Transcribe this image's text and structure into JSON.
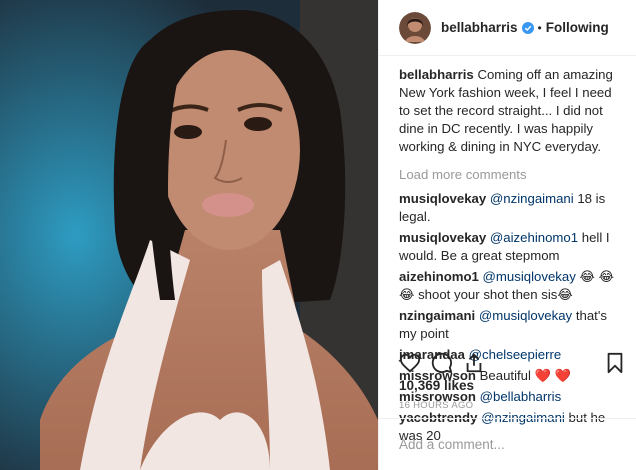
{
  "post": {
    "username": "bellabharris",
    "follow_status": "Following",
    "separator": "•",
    "caption": {
      "username": "bellabharris",
      "text": "Coming off an amazing New York fashion week, I feel I need to set the record straight... I did not dine in DC recently. I was happily working & dining in NYC everyday."
    },
    "load_more": "Load more comments",
    "comments": [
      {
        "user": "musiqlovekay",
        "mention": "@nzingaimani",
        "text": " 18 is legal."
      },
      {
        "user": "musiqlovekay",
        "mention": "@aizehinomo1",
        "text": " hell I would. Be a great stepmom"
      },
      {
        "user": "aizehinomo1",
        "mention": "@musiqlovekay",
        "text": " 😂 😂 😂 shoot your shot then sis😂"
      },
      {
        "user": "nzingaimani",
        "mention": "@musiqlovekay",
        "text": " that's my point"
      },
      {
        "user": "jmarandaa",
        "mention": "@chelseepierre",
        "text": ""
      },
      {
        "user": "missrowson",
        "mention": "",
        "text": " Beautiful ❤️ ❤️"
      },
      {
        "user": "missrowson",
        "mention": "@bellabharris",
        "text": ""
      },
      {
        "user": "yacobtrendy",
        "mention": "@nzingaimani",
        "text": " but he was 20"
      }
    ],
    "likes": "10,369 likes",
    "time": "16 HOURS AGO",
    "add_comment_placeholder": "Add a comment..."
  },
  "icons": {
    "like": "heart-icon",
    "comment": "comment-icon",
    "share": "share-icon",
    "save": "bookmark-icon",
    "verified": "verified-badge-icon"
  },
  "colors": {
    "text": "#262626",
    "muted": "#999999",
    "mention": "#003569",
    "verified": "#3897f0"
  }
}
